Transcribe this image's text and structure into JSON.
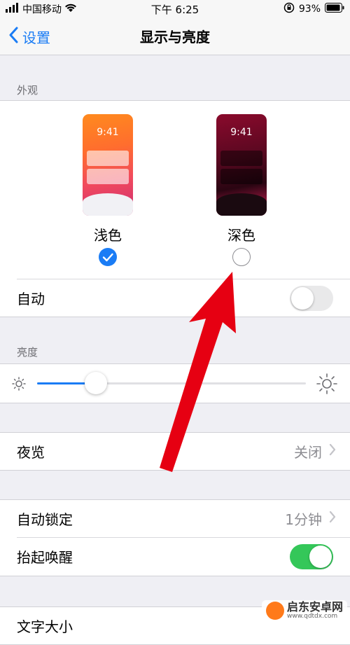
{
  "status_bar": {
    "carrier": "中国移动",
    "time": "下午 6:25",
    "battery_percent": "93%"
  },
  "nav": {
    "back_label": "设置",
    "title": "显示与亮度"
  },
  "appearance": {
    "header": "外观",
    "light": {
      "time": "9:41",
      "label": "浅色",
      "selected": true
    },
    "dark": {
      "time": "9:41",
      "label": "深色",
      "selected": false
    },
    "auto_label": "自动",
    "auto_enabled": false
  },
  "brightness": {
    "header": "亮度",
    "level": 0.22
  },
  "night_shift": {
    "label": "夜览",
    "value": "关闭"
  },
  "auto_lock": {
    "label": "自动锁定",
    "value": "1分钟"
  },
  "raise_to_wake": {
    "label": "抬起唤醒",
    "enabled": true
  },
  "text_size": {
    "label": "文字大小"
  },
  "watermark": {
    "text": "启东安卓网",
    "url": "www.qdtdx.com"
  },
  "colors": {
    "accent": "#1a7cf5",
    "toggle_on": "#34c759",
    "annotation_arrow": "#e60012"
  }
}
